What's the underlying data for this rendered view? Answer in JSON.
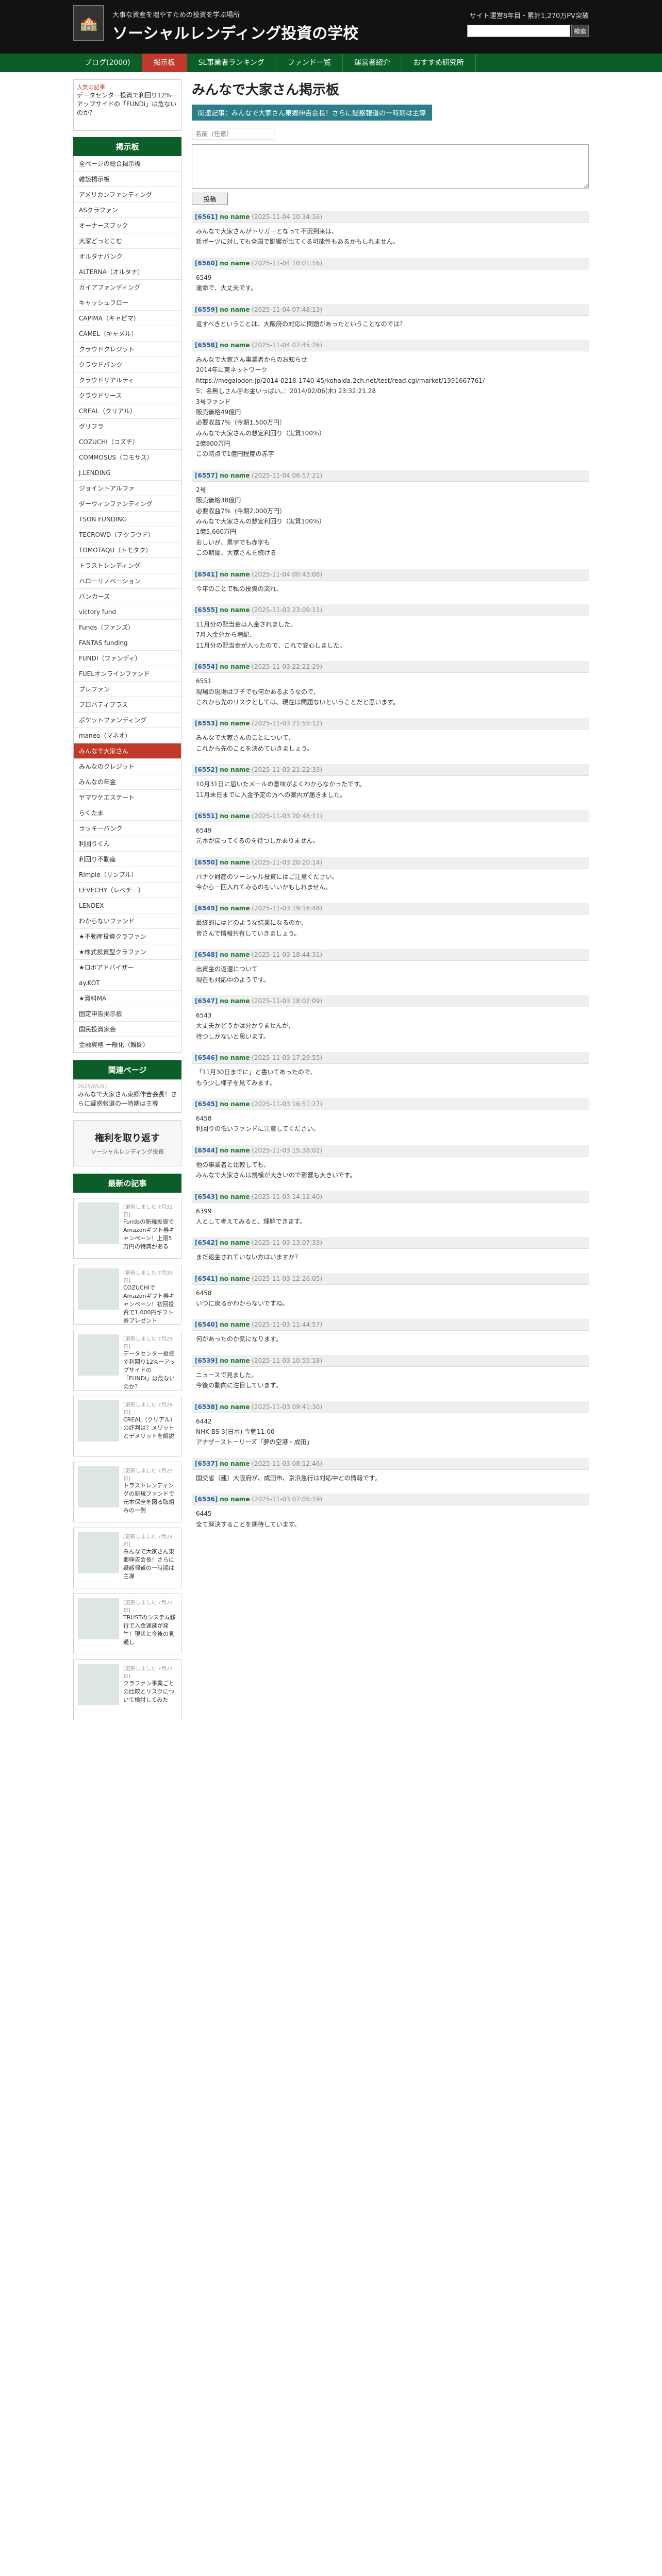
{
  "header": {
    "tagline": "大事な資産を増やすための投資を学ぶ場所",
    "title": "ソーシャルレンディング投資の学校",
    "update_text": "サイト運営8年目・累計1,270万PV突破",
    "search_button": "検索"
  },
  "nav": {
    "items": [
      "ブログ(2000)",
      "掲示板",
      "SL事業者ランキング",
      "ファンド一覧",
      "運営者紹介",
      "おすすめ研究所"
    ],
    "active_index": 1
  },
  "sidebar": {
    "promo": {
      "head": "人気の記事",
      "text": "データセンター投資で利回り12%ーアップサイドの「FUNDi」は危ないのか？"
    },
    "board_title": "掲示板",
    "boards": [
      "全ページの総合掲示板",
      "雑談掲示板",
      "アメリカンファンディング",
      "ASクラファン",
      "オーナーズブック",
      "大家どっとこむ",
      "オルタナバンク",
      "ALTERNA（オルタナ）",
      "ガイアファンディング",
      "キャッシュフロー",
      "CAPIMA（キャピマ）",
      "CAMEL（キャメル）",
      "クラウドクレジット",
      "クラウドバンク",
      "クラウドリアルティ",
      "クラウドリース",
      "CREAL（クリアル）",
      "グリフラ",
      "COZUCHI（コズチ）",
      "COMMOSUS（コモサス）",
      "J.LENDING",
      "ジョイントアルファ",
      "ダーウィンファンディング",
      "TSON FUNDING",
      "TECROWD（テクラウド）",
      "TOMOTAQU（トモタク）",
      "トラストレンディング",
      "ハローリノベーション",
      "バンカーズ",
      "victory fund",
      "Funds（ファンズ）",
      "FANTAS funding",
      "FUNDI（ファンディ）",
      "FUELオンラインファンド",
      "プレファン",
      "プロパティプラス",
      "ポケットファンディング",
      "maneo（マネオ）",
      "みんなで大家さん",
      "みんなのクレジット",
      "みんなの年金",
      "ヤマワケエステート",
      "らくたま",
      "ラッキーバンク",
      "利回りくん",
      "利回り不動産",
      "Rimple（リンプル）",
      "LEVECHY（レベチー）",
      "LENDEX",
      "わからないファンド",
      "★不動産投資クラファン",
      "★株式投資型クラファン",
      "★ロボアドバイザー",
      "ay.KOT",
      "★資料MA",
      "固定申告掲示板",
      "国民投資家会",
      "金融資格 一般化（難関）"
    ],
    "active_board": 38,
    "related_title": "関連ページ",
    "related_date": "2025/05/01",
    "related_text": "みんなで大家さん東郷伸吉会長！さらに疑惑報道の一時期は主導",
    "banner_main": "権利を取り返す",
    "banner_sub": "ソーシャルレンディング投資",
    "recommend_title": "最新の記事",
    "articles": [
      {
        "date": "[更新しました 7月31日]",
        "text": "Fundsの新規投資でAmazonギフト券キャンペーン！上限5万円の特典がある"
      },
      {
        "date": "[更新しました 7月30日]",
        "text": "COZUCHIでAmazonギフト券キャンペーン！初回投資で1,000円ギフト券プレゼント"
      },
      {
        "date": "[更新しました 7月29日]",
        "text": "データセンター投資で利回り12%ーアップサイドの「FUNDi」は危ないのか？"
      },
      {
        "date": "[更新しました 7月28日]",
        "text": "CREAL（クリアル）の評判は？メリットとデメリットを解説"
      },
      {
        "date": "[更新しました 7月25日]",
        "text": "トラストレンディングの新規ファンドで元本保全を図る取組みの一例"
      },
      {
        "date": "[更新しました 7月24日]",
        "text": "みんなで大家さん東郷伸吉会長！さらに疑惑報道の一時期は主導"
      },
      {
        "date": "[更新しました 7月23日]",
        "text": "TRUSTのシステム移行で入金遅延が発生！現状と今後の見通し"
      },
      {
        "date": "[更新しました 7月22日]",
        "text": "クラファン事業ごとの比較とリスクについて検討してみた"
      }
    ]
  },
  "main": {
    "title": "みんなで大家さん掲示板",
    "banner": "関連記事：みんなで大家さん東郷伸吉会長！さらに疑惑報道の一時期は主導",
    "name_placeholder": "名前（任意）",
    "post_button": "投稿",
    "posts": [
      {
        "num": "[6561]",
        "name": "no name",
        "date": "(2025-11-04 10:34:16)",
        "body": "みんなで大家さんがトリガーとなって不況到来は、\n新ポーツに対しても全国で影響が出てくる可能性もあるかもしれません。"
      },
      {
        "num": "[6560]",
        "name": "no name",
        "date": "(2025-11-04 10:01:16)",
        "body": "6549\n運命で、大丈夫です。"
      },
      {
        "num": "[6559]",
        "name": "no name",
        "date": "(2025-11-04 07:48:13)",
        "body": "返すべきということは、大阪府の対応に問題があったということなのでは？"
      },
      {
        "num": "[6558]",
        "name": "no name",
        "date": "(2025-11-04 07:45:26)",
        "body": "みんなで大家さん事業者からのお知らせ\n2014年に東ネットワーク\nhttps://megalodon.jp/2014-0218-1740-45/kohaida.2ch.net/test/read.cgi/market/1391667761/\n5：名無しさん＠お金いっぱい。：2014/02/06(木) 23:32:21.28\n3号ファンド\n販売価格49億円\n必要収益7％（今期1,500万円）\nみんなで大家さんの想定利回り（実質100％）\n2億800万円\nこの時点で1億円程度の赤字"
      },
      {
        "num": "[6557]",
        "name": "no name",
        "date": "(2025-11-04 06:57:21)",
        "body": "2号\n販売価格38億円\n必要収益7％（今期2,000万円）\nみんなで大家さんの想定利回り（実質100％）\n1億5,660万円\nおしいが、黒字でも赤字も\nこの期間、大家さんを続ける"
      },
      {
        "num": "[6541]",
        "name": "no name",
        "date": "(2025-11-04 00:43:08)",
        "body": "今年のことで私の投資の流れ、"
      },
      {
        "num": "[6555]",
        "name": "no name",
        "date": "(2025-11-03 23:09:11)",
        "body": "11月分の配当金は入金されました。\n7月入金分から増配、\n11月分の配当金が入ったので、これで安心しました。"
      },
      {
        "num": "[6554]",
        "name": "no name",
        "date": "(2025-11-03 22:22:29)",
        "body": "6551\n現場の現場はプチでも何かあるようなので、\nこれから先のリスクとしては、現在は問題ないということだと思います。"
      },
      {
        "num": "[6553]",
        "name": "no name",
        "date": "(2025-11-03 21:55:12)",
        "body": "みんなで大家さんのことについて、\nこれから先のことを決めていきましょう。"
      },
      {
        "num": "[6552]",
        "name": "no name",
        "date": "(2025-11-03 21:22:33)",
        "body": "10月31日に届いたメールの意味がよくわからなかったです。\n11月末日までに入金予定の方への案内が届きました。"
      },
      {
        "num": "[6551]",
        "name": "no name",
        "date": "(2025-11-03 20:48:11)",
        "body": "6549\n元本が戻ってくるのを待つしかありません。"
      },
      {
        "num": "[6550]",
        "name": "no name",
        "date": "(2025-11-03 20:20:14)",
        "body": "パナク財産のソーシャル投資にはご注意ください。\n今から一回入れてみるのもいいかもしれません。"
      },
      {
        "num": "[6549]",
        "name": "no name",
        "date": "(2025-11-03 19:16:48)",
        "body": "最終的にはどのような結果になるのか、\n皆さんで情報共有していきましょう。"
      },
      {
        "num": "[6548]",
        "name": "no name",
        "date": "(2025-11-03 18:44:31)",
        "body": "出資金の返還について\n現在も対応中のようです。"
      },
      {
        "num": "[6547]",
        "name": "no name",
        "date": "(2025-11-03 18:02:09)",
        "body": "6543\n大丈夫かどうかは分かりませんが、\n待つしかないと思います。"
      },
      {
        "num": "[6546]",
        "name": "no name",
        "date": "(2025-11-03 17:29:55)",
        "body": "「11月30日までに」と書いてあったので、\nもう少し様子を見てみます。"
      },
      {
        "num": "[6545]",
        "name": "no name",
        "date": "(2025-11-03 16:51:27)",
        "body": "6458\n利回りの低いファンドに注意してください。"
      },
      {
        "num": "[6544]",
        "name": "no name",
        "date": "(2025-11-03 15:38:02)",
        "body": "他の事業者と比較しても、\nみんなで大家さんは規模が大きいので影響も大きいです。"
      },
      {
        "num": "[6543]",
        "name": "no name",
        "date": "(2025-11-03 14:12:40)",
        "body": "6399\n人として考えてみると、理解できます。"
      },
      {
        "num": "[6542]",
        "name": "no name",
        "date": "(2025-11-03 13:07:33)",
        "body": "まだ返金されていない方はいますか？"
      },
      {
        "num": "[6541]",
        "name": "no name",
        "date": "(2025-11-03 12:26:05)",
        "body": "6458\nいつに戻るかわからないですね。"
      },
      {
        "num": "[6540]",
        "name": "no name",
        "date": "(2025-11-03 11:44:57)",
        "body": "何があったのか気になります。"
      },
      {
        "num": "[6539]",
        "name": "no name",
        "date": "(2025-11-03 10:55:18)",
        "body": "ニュースで見ました。\n今後の動向に注目しています。"
      },
      {
        "num": "[6538]",
        "name": "no name",
        "date": "(2025-11-03 09:41:30)",
        "body": "6442\nNHK BS 3(日本) 今朝11:00\nアナザーストーリーズ「夢の空港・成田」"
      },
      {
        "num": "[6537]",
        "name": "no name",
        "date": "(2025-11-03 08:12:46)",
        "body": "国交省（建）大阪府が、成田市、京浜急行は対応中との情報です。"
      },
      {
        "num": "[6536]",
        "name": "no name",
        "date": "(2025-11-03 07:05:19)",
        "body": "6445\n全て解決することを期待しています。"
      }
    ]
  }
}
